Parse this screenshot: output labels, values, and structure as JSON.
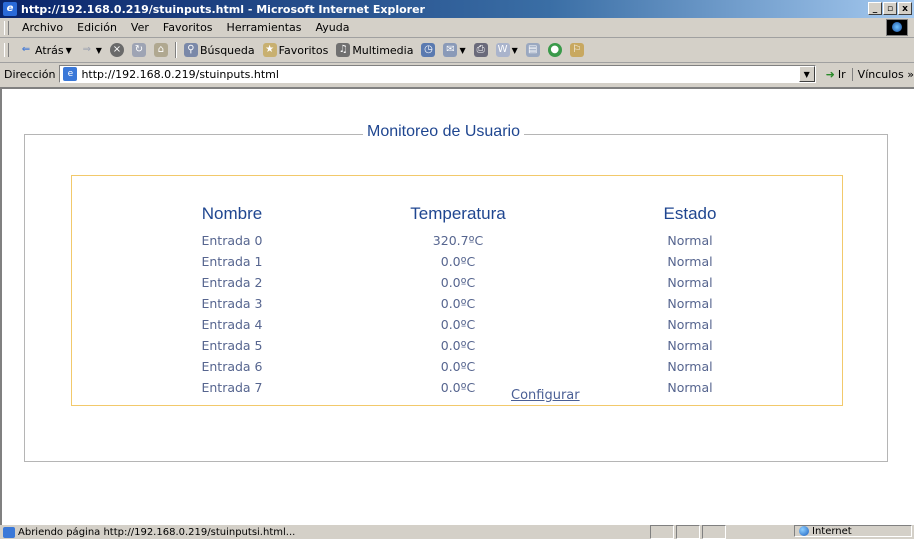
{
  "window": {
    "title": "http://192.168.0.219/stuinputs.html - Microsoft Internet Explorer",
    "controls": [
      "_",
      "8",
      "x"
    ]
  },
  "menu": [
    "Archivo",
    "Edición",
    "Ver",
    "Favoritos",
    "Herramientas",
    "Ayuda"
  ],
  "toolbar": {
    "back": "Atrás",
    "search": "Búsqueda",
    "favorites": "Favoritos",
    "multimedia": "Multimedia"
  },
  "address": {
    "label": "Dirección",
    "url": "http://192.168.0.219/stuinputs.html",
    "go": "Ir",
    "links": "Vínculos »"
  },
  "page": {
    "legend": "Monitoreo de Usuario",
    "headers": {
      "name": "Nombre",
      "temp": "Temperatura",
      "status": "Estado"
    },
    "rows": [
      {
        "name": "Entrada 0",
        "temp": "320.7ºC",
        "status": "Normal"
      },
      {
        "name": "Entrada 1",
        "temp": "0.0ºC",
        "status": "Normal"
      },
      {
        "name": "Entrada 2",
        "temp": "0.0ºC",
        "status": "Normal"
      },
      {
        "name": "Entrada 3",
        "temp": "0.0ºC",
        "status": "Normal"
      },
      {
        "name": "Entrada 4",
        "temp": "0.0ºC",
        "status": "Normal"
      },
      {
        "name": "Entrada 5",
        "temp": "0.0ºC",
        "status": "Normal"
      },
      {
        "name": "Entrada 6",
        "temp": "0.0ºC",
        "status": "Normal"
      },
      {
        "name": "Entrada 7",
        "temp": "0.0ºC",
        "status": "Normal"
      }
    ],
    "config_link": "Configurar"
  },
  "status": {
    "text": "Abriendo página http://192.168.0.219/stuinputsi.html...",
    "zone": "Internet"
  },
  "colors": {
    "heading": "#1f4690",
    "cell_text": "#56658f",
    "inner_border": "#f2c96b"
  }
}
